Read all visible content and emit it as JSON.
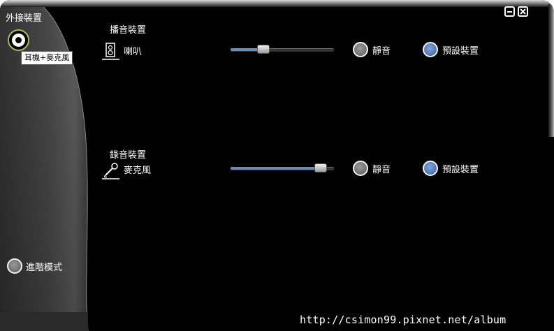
{
  "window": {
    "minimize_icon": "minimize-icon",
    "close_icon": "close-icon"
  },
  "sidebar": {
    "title": "外接裝置",
    "device_button_icon": "headset-jack-icon",
    "tooltip": "耳機+麥克風",
    "advanced_mode_label": "進階模式"
  },
  "playback": {
    "section_title": "播音裝置",
    "device_icon": "speaker-icon",
    "device_name": "喇叭",
    "volume": 0.29,
    "mute_label": "靜音",
    "mute_selected": false,
    "default_label": "預設裝置",
    "default_selected": true
  },
  "recording": {
    "section_title": "錄音裝置",
    "device_icon": "microphone-icon",
    "device_name": "麥克風",
    "volume": 0.92,
    "mute_label": "靜音",
    "mute_selected": false,
    "default_label": "預設裝置",
    "default_selected": true
  },
  "watermark": "http://csimon99.pixnet.net/album",
  "colors": {
    "background": "#000000",
    "slider_fill": "#6b8db5",
    "radio_selected": "#3563a8",
    "radio_unselected": "#7a7a7a",
    "tooltip_bg": "#ffffff",
    "headset_ring": "#9fbf5a"
  }
}
